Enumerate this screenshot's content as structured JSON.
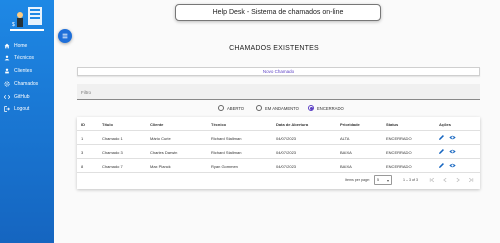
{
  "header": {
    "title": "Help Desk - Sistema de chamados on-line"
  },
  "sidebar": {
    "items": [
      {
        "label": "Home",
        "icon": "home-icon"
      },
      {
        "label": "Técnicos",
        "icon": "person-icon"
      },
      {
        "label": "Clientes",
        "icon": "user-icon"
      },
      {
        "label": "Chamados",
        "icon": "gear-icon"
      },
      {
        "label": "GitHub",
        "icon": "code-icon"
      },
      {
        "label": "Logout",
        "icon": "logout-icon"
      }
    ]
  },
  "page": {
    "title": "CHAMADOS EXISTENTES",
    "new_button": "Novo Chamado"
  },
  "filter": {
    "placeholder": "Filtro"
  },
  "radios": [
    {
      "label": "ABERTO",
      "selected": false
    },
    {
      "label": "EM ANDAMENTO",
      "selected": false
    },
    {
      "label": "ENCERRADO",
      "selected": true
    }
  ],
  "table": {
    "columns": [
      "ID",
      "Título",
      "Cliente",
      "Técnico",
      "Data de Abertura",
      "Prioridade",
      "Status",
      "Ações"
    ],
    "rows": [
      {
        "id": "1",
        "titulo": "Chamado 1",
        "cliente": "Mário Curie",
        "tecnico": "Richard Stallman",
        "data": "04/07/2023",
        "prioridade": "ALTA",
        "status": "ENCERRADO"
      },
      {
        "id": "3",
        "titulo": "Chamado 3",
        "cliente": "Charles Darwin",
        "tecnico": "Richard Stallman",
        "data": "04/07/2023",
        "prioridade": "BAIXA",
        "status": "ENCERRADO"
      },
      {
        "id": "8",
        "titulo": "Chamado 7",
        "cliente": "Max Planck",
        "tecnico": "Ryan Gommen",
        "data": "04/07/2023",
        "prioridade": "BAIXA",
        "status": "ENCERRADO"
      }
    ]
  },
  "paginator": {
    "items_per_page_label": "Items per page:",
    "page_size": "5",
    "range": "1 – 3 of 3"
  },
  "colors": {
    "sidebar": "#1e88e5",
    "accent": "#5b3fc4",
    "action_icon": "#1565c0"
  }
}
